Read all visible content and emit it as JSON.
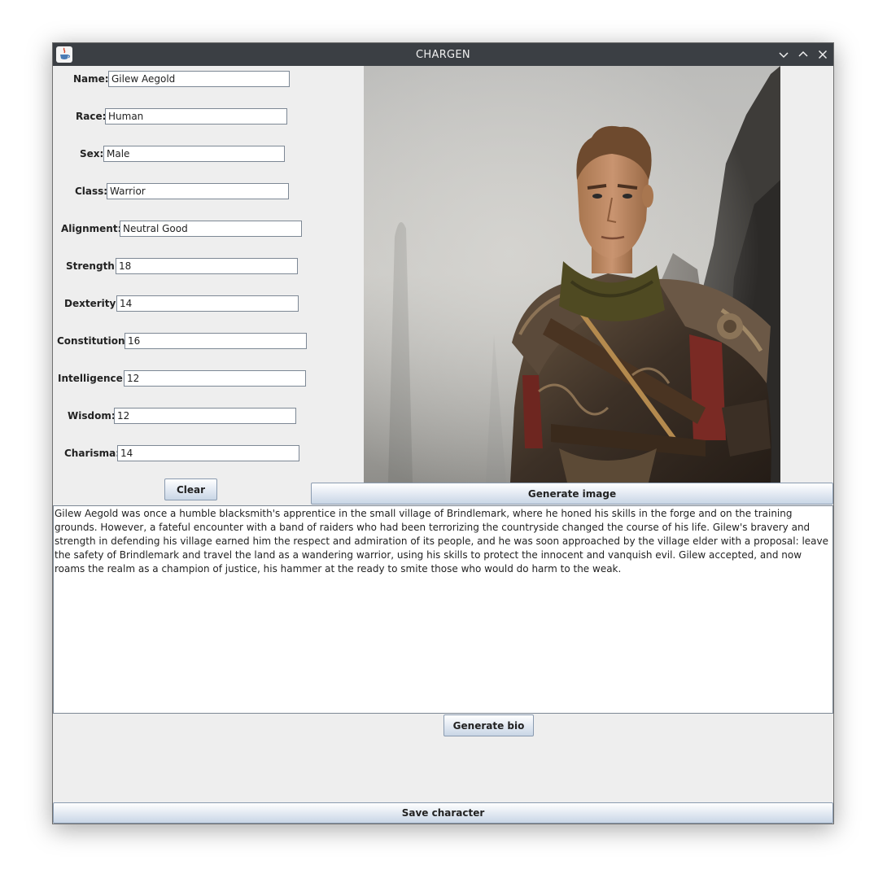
{
  "window": {
    "title": "CHARGEN"
  },
  "form": {
    "fields": [
      {
        "label": "Name:",
        "value": "Gilew Aegold"
      },
      {
        "label": "Race:",
        "value": "Human"
      },
      {
        "label": "Sex:",
        "value": "Male"
      },
      {
        "label": "Class:",
        "value": "Warrior"
      },
      {
        "label": "Alignment:",
        "value": "Neutral Good"
      },
      {
        "label": "Strength:",
        "value": "18"
      },
      {
        "label": "Dexterity:",
        "value": "14"
      },
      {
        "label": "Constitution:",
        "value": "16"
      },
      {
        "label": "Intelligence:",
        "value": "12"
      },
      {
        "label": "Wisdom:",
        "value": "12"
      },
      {
        "label": "Charisma:",
        "value": "14"
      }
    ],
    "clear_label": "Clear"
  },
  "image_panel": {
    "generate_label": "Generate image"
  },
  "bio": {
    "text": "Gilew Aegold was once a humble blacksmith's apprentice in the small village of Brindlemark, where he honed his skills in the forge and on the training grounds. However, a fateful encounter with a band of raiders who had been terrorizing the countryside changed the course of his life. Gilew's bravery and strength in defending his village earned him the respect and admiration of its people, and he was soon approached by the village elder with a proposal: leave the safety of Brindlemark and travel the land as a wandering warrior, using his skills to protect the innocent and vanquish evil. Gilew accepted, and now roams the realm as a champion of justice, his hammer at the ready to smite those who would do harm to the weak.",
    "generate_label": "Generate bio"
  },
  "footer": {
    "save_label": "Save character"
  },
  "icons": {
    "app": "java-cup-icon",
    "minimize": "chevron-down-icon",
    "maximize": "chevron-up-icon",
    "close": "close-icon"
  },
  "colors": {
    "titlebar": "#3b3f44",
    "panel": "#eeeeee",
    "button_top": "#ffffff",
    "button_bottom": "#c9d6e6",
    "field_border": "#7d8895"
  }
}
